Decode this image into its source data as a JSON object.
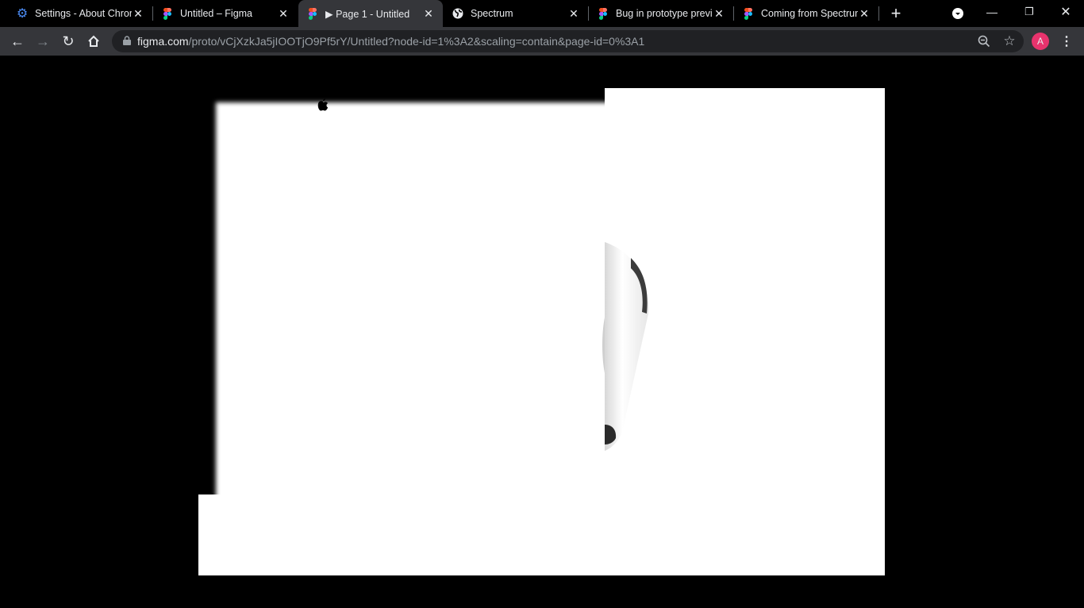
{
  "tabs": [
    {
      "title": "Settings - About Chrome",
      "icon": "gear-icon",
      "active": false
    },
    {
      "title": "Untitled – Figma",
      "icon": "figma-icon",
      "active": false
    },
    {
      "title": "▶ Page 1 - Untitled",
      "icon": "figma-icon",
      "active": true
    },
    {
      "title": "Spectrum",
      "icon": "globe-icon",
      "active": false
    },
    {
      "title": "Bug in prototype preview",
      "icon": "figma-icon",
      "active": false
    },
    {
      "title": "Coming from Spectrum",
      "icon": "figma-icon",
      "active": false
    }
  ],
  "address": {
    "host": "figma.com",
    "path": "/proto/vCjXzkJa5jIOOTjO9Pf5rY/Untitled?node-id=1%3A2&scaling=contain&page-id=0%3A1"
  },
  "profile": {
    "initial": "A",
    "color": "#e8336d"
  },
  "colors": {
    "tabbar": "#000000",
    "toolbar": "#35363a",
    "omnibox": "#202124"
  }
}
